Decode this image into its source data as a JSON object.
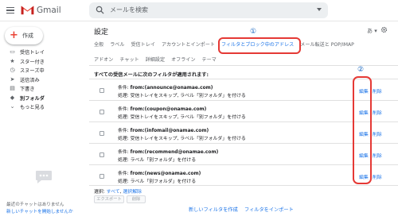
{
  "header": {
    "brand": "Gmail",
    "search_placeholder": "メールを検索"
  },
  "sidebar": {
    "compose_label": "作成",
    "items": [
      {
        "icon": "inbox-icon",
        "label": "受信トレイ"
      },
      {
        "icon": "star-icon",
        "label": "スター付き"
      },
      {
        "icon": "clock-icon",
        "label": "スヌーズ中"
      },
      {
        "icon": "send-icon",
        "label": "送信済み"
      },
      {
        "icon": "draft-icon",
        "label": "下書き"
      },
      {
        "icon": "label-icon",
        "label": "別フォルダ"
      },
      {
        "icon": "chevron-down-icon",
        "label": "もっと見る"
      }
    ],
    "chat_empty": "最近のチャットはありません",
    "chat_start": "新しいチャットを開始しませんか"
  },
  "settings": {
    "title": "設定",
    "lang_label": "あ",
    "tabs_row1": [
      "全般",
      "ラベル",
      "受信トレイ",
      "アカウントとインポート",
      "フィルタとブロック中のアドレス",
      "メール転送と POP/IMAP"
    ],
    "tabs_row2": [
      "アドオン",
      "チャット",
      "詳細設定",
      "オフライン",
      "テーマ"
    ],
    "active_tab": "フィルタとブロック中のアドレス",
    "notice": "すべての受信メールに次のフィルタが適用されます:",
    "filters": [
      {
        "cond_prefix": "条件:",
        "cond": "from:(announce@onamae.com)",
        "action": "処理: 受信トレイをスキップ, ラベル「別フォルダ」を付ける"
      },
      {
        "cond_prefix": "条件:",
        "cond": "from:(coupon@onamae.com)",
        "action": "処理: 受信トレイをスキップ, ラベル「別フォルダ」を付ける"
      },
      {
        "cond_prefix": "条件:",
        "cond": "from:(infomail@onamae.com)",
        "action": "処理: 受信トレイをスキップ, ラベル「別フォルダ」を付ける"
      },
      {
        "cond_prefix": "条件:",
        "cond": "from:(recommend@onamae.com)",
        "action": "処理: ラベル「別フォルダ」を付ける"
      },
      {
        "cond_prefix": "条件:",
        "cond": "from:(news@onamae.com)",
        "action": "処理: ラベル「別フォルダ」を付ける"
      }
    ],
    "edit_label": "編集",
    "delete_label": "削除",
    "select_prefix": "選択: ",
    "select_all": "すべて",
    "select_sep": ", ",
    "select_none": "選択解除",
    "export_button": "エクスポート",
    "delete_button": "削除",
    "new_filter": "新しいフィルタを作成",
    "import_filter": "フィルタをインポート"
  },
  "annotations": {
    "marker1": "①",
    "marker2": "②",
    "color": "#e53935"
  }
}
